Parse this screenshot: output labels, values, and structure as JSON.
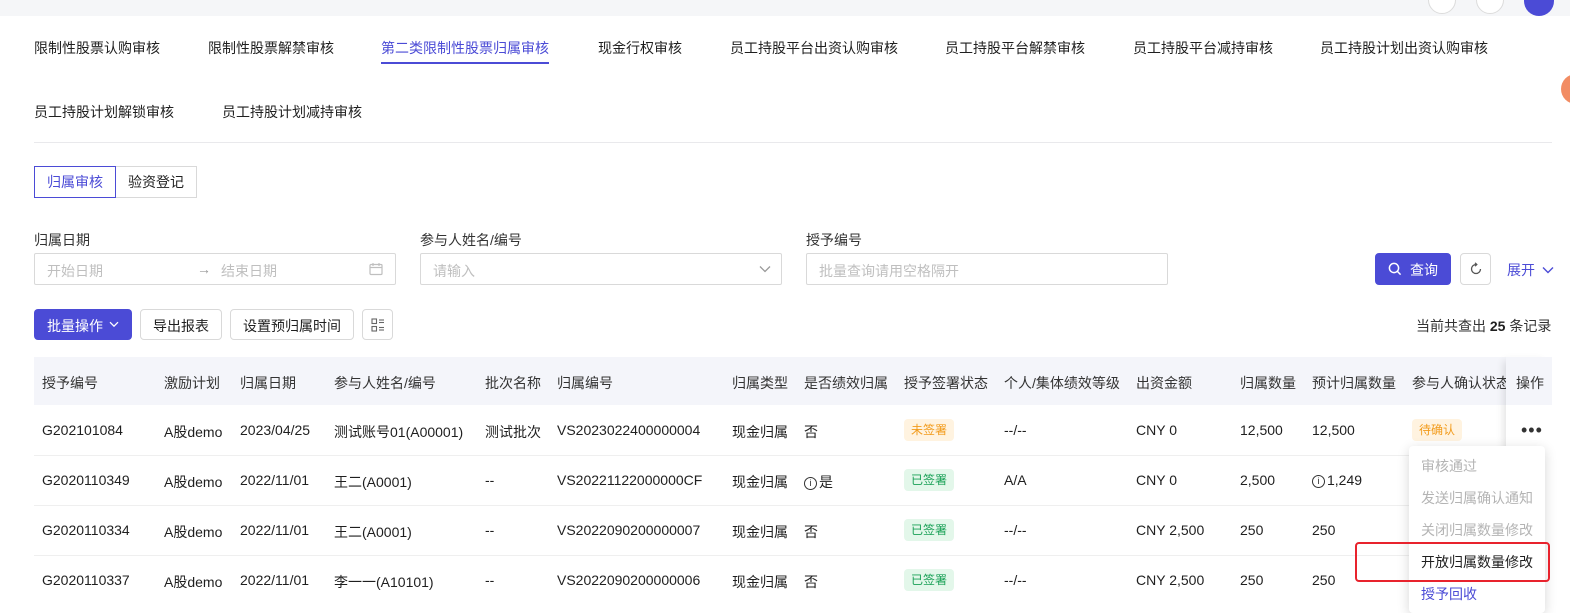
{
  "tabs": [
    {
      "label": "限制性股票认购审核"
    },
    {
      "label": "限制性股票解禁审核"
    },
    {
      "label": "第二类限制性股票归属审核"
    },
    {
      "label": "现金行权审核"
    },
    {
      "label": "员工持股平台出资认购审核"
    },
    {
      "label": "员工持股平台解禁审核"
    },
    {
      "label": "员工持股平台减持审核"
    },
    {
      "label": "员工持股计划出资认购审核"
    },
    {
      "label": "员工持股计划解锁审核"
    },
    {
      "label": "员工持股计划减持审核"
    }
  ],
  "active_tab": "第二类限制性股票归属审核",
  "segments": [
    {
      "label": "归属审核"
    },
    {
      "label": "验资登记"
    }
  ],
  "filters": {
    "date_label": "归属日期",
    "start_placeholder": "开始日期",
    "end_placeholder": "结束日期",
    "participant_label": "参与人姓名/编号",
    "participant_placeholder": "请输入",
    "grant_label": "授予编号",
    "grant_placeholder": "批量查询请用空格隔开",
    "query_label": "查询",
    "expand_label": "展开"
  },
  "toolbar": {
    "batch_label": "批量操作",
    "export_label": "导出报表",
    "set_time_label": "设置预归属时间",
    "count_prefix": "当前共查出",
    "count_value": "25",
    "count_suffix": "条记录"
  },
  "table": {
    "columns": [
      "授予编号",
      "激励计划",
      "归属日期",
      "参与人姓名/编号",
      "批次名称",
      "归属编号",
      "归属类型",
      "是否绩效归属",
      "授予签署状态",
      "个人/集体绩效等级",
      "出资金额",
      "归属数量",
      "预计归属数量",
      "参与人确认状态",
      "操作"
    ],
    "rows": [
      {
        "grant_no": "G202101084",
        "plan": "A股demo",
        "date": "2023/04/25",
        "participant": "测试账号01(A00001)",
        "batch": "测试批次",
        "vest_no": "VS2023022400000004",
        "type": "现金归属",
        "perf": "否",
        "sign": "未签署",
        "level": "--/--",
        "amount": "CNY 0",
        "qty": "12,500",
        "est_qty": "12,500",
        "confirm": "待确认"
      },
      {
        "grant_no": "G2020110349",
        "plan": "A股demo",
        "date": "2022/11/01",
        "participant": "王二(A0001)",
        "batch": "--",
        "vest_no": "VS20221122000000CF",
        "type": "现金归属",
        "perf": "是",
        "sign": "已签署",
        "level": "A/A",
        "amount": "CNY 0",
        "qty": "2,500",
        "est_qty": "1,249",
        "confirm": ""
      },
      {
        "grant_no": "G2020110334",
        "plan": "A股demo",
        "date": "2022/11/01",
        "participant": "王二(A0001)",
        "batch": "--",
        "vest_no": "VS2022090200000007",
        "type": "现金归属",
        "perf": "否",
        "sign": "已签署",
        "level": "--/--",
        "amount": "CNY 2,500",
        "qty": "250",
        "est_qty": "250",
        "confirm": ""
      },
      {
        "grant_no": "G2020110337",
        "plan": "A股demo",
        "date": "2022/11/01",
        "participant": "李一一(A10101)",
        "batch": "--",
        "vest_no": "VS2022090200000006",
        "type": "现金归属",
        "perf": "否",
        "sign": "已签署",
        "level": "--/--",
        "amount": "CNY 2,500",
        "qty": "250",
        "est_qty": "250",
        "confirm": ""
      }
    ]
  },
  "action_menu": {
    "items": [
      {
        "label": "审核通过",
        "state": "disabled"
      },
      {
        "label": "发送归属确认通知",
        "state": "disabled"
      },
      {
        "label": "关闭归属数量修改",
        "state": "disabled"
      },
      {
        "label": "开放归属数量修改",
        "state": "highlighted"
      },
      {
        "label": "授予回收",
        "state": "link"
      }
    ]
  },
  "icons": {
    "more": "more-horizontal-icon",
    "calendar": "calendar-icon",
    "search": "search-icon",
    "refresh": "refresh-icon",
    "settings": "column-settings-icon",
    "info": "info-circle-icon"
  },
  "colors": {
    "primary": "#4b4bd6",
    "warning_tag": "#f29b1b",
    "success_tag": "#1aa157",
    "highlight_border": "#e8232d"
  }
}
